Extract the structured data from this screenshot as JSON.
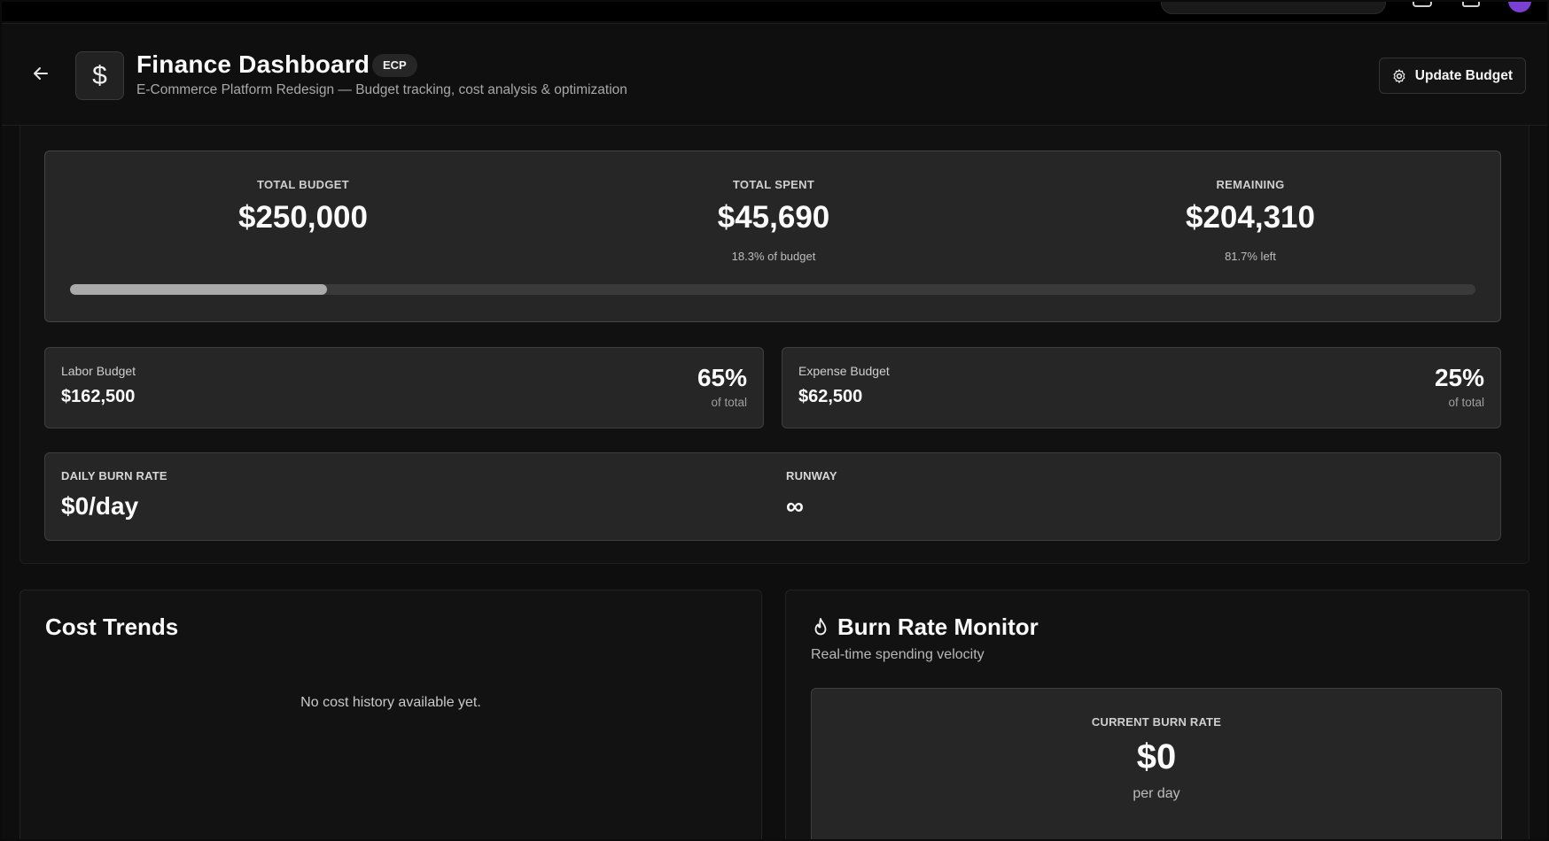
{
  "header": {
    "logo_glyph": "$",
    "title": "Finance Dashboard",
    "badge": "ECP",
    "subtitle": "E-Commerce Platform Redesign — Budget tracking, cost analysis & optimization",
    "update_button": "Update Budget"
  },
  "budget": {
    "total_label": "TOTAL BUDGET",
    "total_value": "$250,000",
    "spent_label": "TOTAL SPENT",
    "spent_value": "$45,690",
    "spent_sub": "18.3% of budget",
    "remaining_label": "REMAINING",
    "remaining_value": "$204,310",
    "remaining_sub": "81.7% left",
    "spent_fraction": 0.183
  },
  "labor": {
    "label": "Labor Budget",
    "value": "$162,500",
    "pct": "65%",
    "pct_sub": "of total"
  },
  "expense": {
    "label": "Expense Budget",
    "value": "$62,500",
    "pct": "25%",
    "pct_sub": "of total"
  },
  "burn": {
    "daily_label": "DAILY BURN RATE",
    "daily_value": "$0/day",
    "runway_label": "RUNWAY",
    "runway_value": "∞"
  },
  "cost_trends": {
    "title": "Cost Trends",
    "empty": "No cost history available yet."
  },
  "burn_monitor": {
    "title": "Burn Rate Monitor",
    "subtitle": "Real-time spending velocity",
    "current_label": "CURRENT BURN RATE",
    "current_value": "$0",
    "current_sub": "per day"
  },
  "icons": {
    "back": "arrow-left-icon",
    "logo": "dollar-icon",
    "gear": "gear-icon",
    "flame": "flame-icon"
  }
}
